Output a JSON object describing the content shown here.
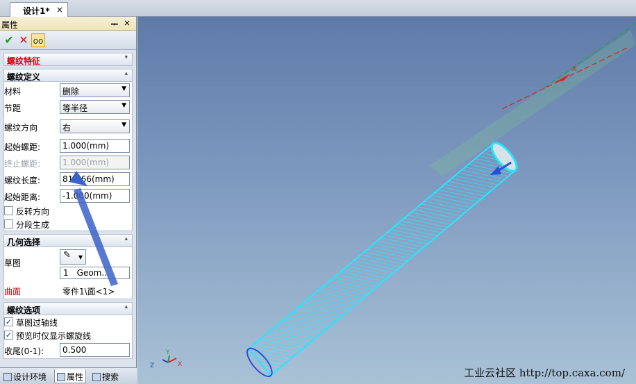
{
  "document_tab": {
    "title": "设计1*",
    "close": "×"
  },
  "panel": {
    "title": "属性",
    "pin": "ᆍ",
    "close": "×",
    "feature_section": "螺纹特征",
    "definition": {
      "header": "螺纹定义",
      "material": {
        "label": "材料",
        "value": "删除"
      },
      "pitch": {
        "label": "节距",
        "value": "等半径"
      },
      "direction": {
        "label": "螺纹方向",
        "value": "右"
      },
      "start_pitch": {
        "label": "起始螺距:",
        "value": "1.000(mm)"
      },
      "end_pitch": {
        "label": "终止螺距:",
        "value": "1.000(mm)"
      },
      "length": {
        "label": "螺纹长度:",
        "value": "81.466(mm)"
      },
      "start_distance": {
        "label": "起始距离:",
        "value": "-1.000(mm)"
      },
      "reverse": {
        "label": "反转方向",
        "checked": false
      },
      "segment": {
        "label": "分段生成",
        "checked": false
      }
    },
    "geometry": {
      "header": "几何选择",
      "sketch_label": "草图",
      "sketch_item_num": "1",
      "sketch_item_name": "Geom...",
      "surface_label": "曲面",
      "surface_value": "零件1\\面<1>"
    },
    "options": {
      "header": "螺纹选项",
      "sketch_axis": {
        "label": "草图过轴线",
        "checked": true
      },
      "preview_helix": {
        "label": "预览时仅显示螺旋线",
        "checked": true
      },
      "tail": {
        "label": "收尾(0-1):",
        "value": "0.500"
      }
    }
  },
  "bottom_tabs": [
    {
      "label": "设计环境"
    },
    {
      "label": "属性"
    },
    {
      "label": "搜索"
    }
  ],
  "viewport": {
    "watermark": "工业云社区 http://top.caxa.com/",
    "triad": {
      "x": "X",
      "y": "Y",
      "z": "Z"
    },
    "axis_label": "X"
  },
  "colors": {
    "thread": "#27e6ff",
    "direction_arrow": "#2a4fd6",
    "annotation_arrow": "#3a62c8",
    "feature_header": "#d00000"
  }
}
